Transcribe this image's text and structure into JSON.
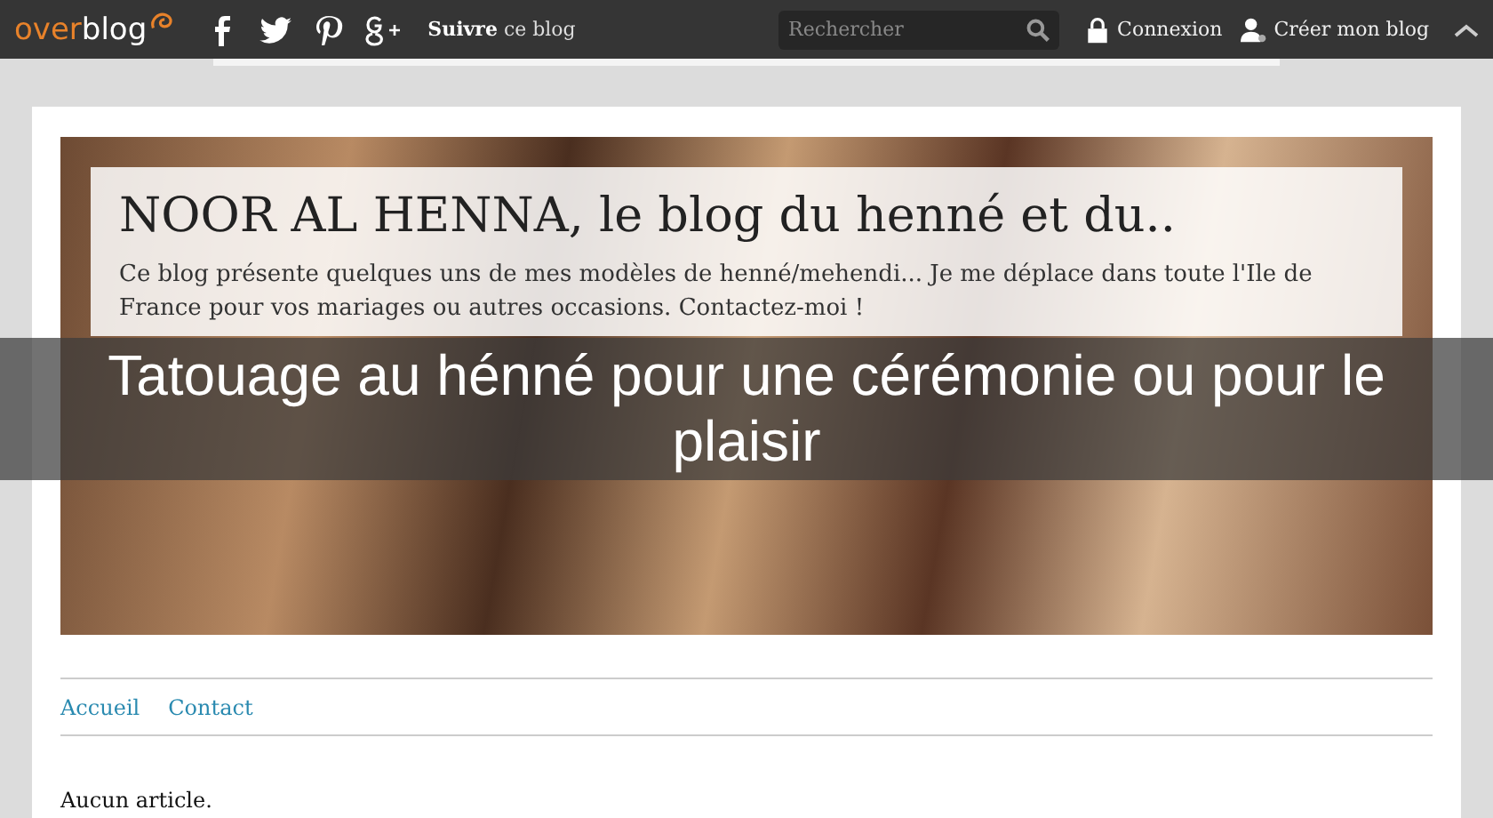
{
  "topbar": {
    "logo": {
      "first": "over",
      "second": "blog"
    },
    "follow": {
      "bold": "Suivre",
      "rest": "ce blog"
    },
    "search": {
      "placeholder": "Rechercher"
    },
    "login": "Connexion",
    "create": "Créer mon blog"
  },
  "banner": {
    "title": "NOOR AL HENNA, le blog du henné et du..",
    "description": "Ce blog présente quelques uns de mes modèles de henné/mehendi... Je me déplace dans toute l'Ile de France pour vos mariages ou autres occasions. Contactez-moi !"
  },
  "caption": "Tatouage au hénné pour une cérémonie ou pour le plaisir",
  "nav": [
    {
      "label": "Accueil"
    },
    {
      "label": "Contact"
    }
  ],
  "content": {
    "message": "Aucun article."
  }
}
